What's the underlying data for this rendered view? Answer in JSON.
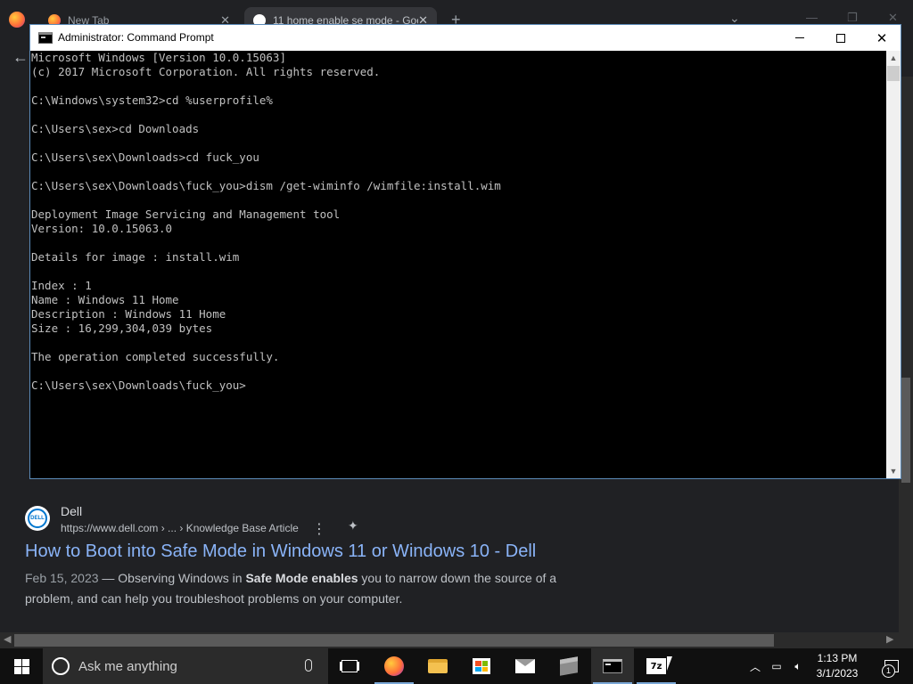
{
  "browser": {
    "tabs": [
      {
        "label": "New Tab"
      },
      {
        "label": "11 home enable se mode - Goo"
      }
    ],
    "new_tab_glyph": "+",
    "tab_list_glyph": "⌄",
    "back_glyph": "←",
    "result": {
      "site": "Dell",
      "url": "https://www.dell.com › ... › Knowledge Base Article",
      "title": "How to Boot into Safe Mode in Windows 11 or Windows 10 - Dell",
      "date": "Feb 15, 2023",
      "snippet_pre": " — Observing Windows in ",
      "snippet_bold": "Safe Mode enables",
      "snippet_post": " you to narrow down the source of a problem, and can help you troubleshoot problems on your computer.",
      "logo_text": "DELL"
    }
  },
  "cmd": {
    "title": "Administrator: Command Prompt",
    "lines": [
      "Microsoft Windows [Version 10.0.15063]",
      "(c) 2017 Microsoft Corporation. All rights reserved.",
      "",
      "C:\\Windows\\system32>cd %userprofile%",
      "",
      "C:\\Users\\sex>cd Downloads",
      "",
      "C:\\Users\\sex\\Downloads>cd fuck_you",
      "",
      "C:\\Users\\sex\\Downloads\\fuck_you>dism /get-wiminfo /wimfile:install.wim",
      "",
      "Deployment Image Servicing and Management tool",
      "Version: 10.0.15063.0",
      "",
      "Details for image : install.wim",
      "",
      "Index : 1",
      "Name : Windows 11 Home",
      "Description : Windows 11 Home",
      "Size : 16,299,304,039 bytes",
      "",
      "The operation completed successfully.",
      "",
      "C:\\Users\\sex\\Downloads\\fuck_you>"
    ],
    "colors": {
      "background": "#000000",
      "text": "#c0c0c0"
    }
  },
  "taskbar": {
    "search_placeholder": "Ask me anything",
    "sevenzip_label": "7z",
    "time": "1:13 PM",
    "date": "3/1/2023",
    "notification_count": "1"
  },
  "icons": [
    "firefox-icon",
    "search-icon",
    "microphone-icon",
    "task-view-icon",
    "file-explorer-icon",
    "store-icon",
    "mail-icon",
    "package-icon",
    "command-prompt-icon",
    "7zip-icon",
    "chevron-up-icon",
    "network-icon",
    "volume-icon",
    "action-center-icon"
  ]
}
